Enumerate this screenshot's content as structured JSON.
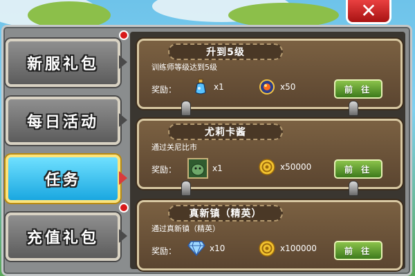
{
  "window": {
    "close_icon": "close-x-icon"
  },
  "tabs": [
    {
      "label": "新服礼包",
      "active": false,
      "has_badge": true
    },
    {
      "label": "每日活动",
      "active": false,
      "has_badge": false
    },
    {
      "label": "任务",
      "active": true,
      "has_badge": false
    },
    {
      "label": "充值礼包",
      "active": false,
      "has_badge": true
    }
  ],
  "tasks": [
    {
      "title": "升到5级",
      "description": "训练师等级达到5级",
      "reward_label": "奖励：",
      "rewards": [
        {
          "icon": "potion-icon",
          "count": "x1"
        },
        {
          "icon": "orb-icon",
          "count": "x50"
        }
      ],
      "button": "前 往"
    },
    {
      "title": "尤莉卡酱",
      "description": "通过关尼比市",
      "reward_label": "奖励：",
      "rewards": [
        {
          "icon": "pet-egg-icon",
          "count": "x1"
        },
        {
          "icon": "gold-coin-icon",
          "count": "x50000"
        }
      ],
      "button": "前 往"
    },
    {
      "title": "真新镇（精英）",
      "description": "通过真新镇（精英）",
      "reward_label": "奖励：",
      "rewards": [
        {
          "icon": "diamond-icon",
          "count": "x10"
        },
        {
          "icon": "gold-coin-icon",
          "count": "x100000"
        }
      ],
      "button": "前 往"
    }
  ]
}
